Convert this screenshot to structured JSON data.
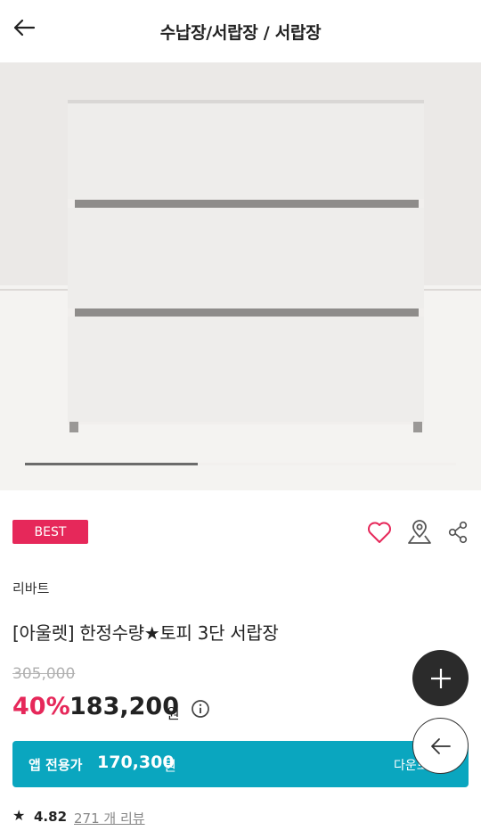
{
  "header": {
    "title": "수납장/서랍장 / 서랍장",
    "back_icon": "arrow-left-icon"
  },
  "gallery": {
    "image_alt": "3단 서랍장 제품 사진",
    "progress_fraction": 0.4
  },
  "product": {
    "badge": "BEST",
    "brand": "리바트",
    "name": "[아울렛] 한정수량★토피 3단 서랍장",
    "original_price": "305,000",
    "discount_rate": "40%",
    "price": "183,200",
    "currency": "원",
    "actions": [
      "heart-icon",
      "location-pin-icon",
      "share-icon"
    ]
  },
  "app_offer": {
    "label": "앱 전용가",
    "price": "170,300",
    "currency": "원",
    "download_label": "다운로"
  },
  "rating": {
    "star": "★",
    "score": "4.82",
    "reviews": "271 개 리뷰"
  },
  "colors": {
    "accent": "#e6285a",
    "app_bar": "#0aa6bf",
    "fab_dark": "#2b2b2b"
  }
}
